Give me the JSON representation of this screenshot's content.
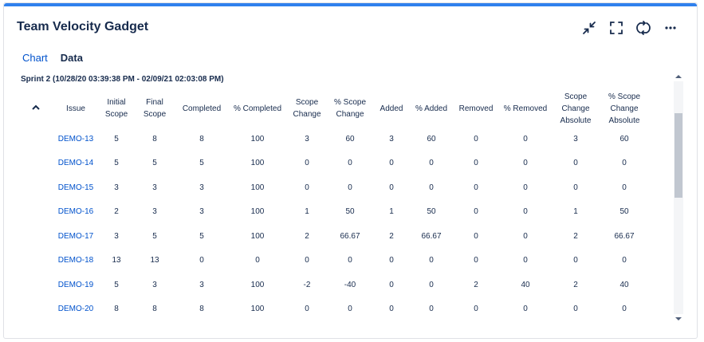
{
  "gadget": {
    "title": "Team Velocity Gadget"
  },
  "tabs": [
    {
      "label": "Chart",
      "active": false
    },
    {
      "label": "Data",
      "active": true
    }
  ],
  "sprint_label": "Sprint 2 (10/28/20 03:39:38 PM - 02/09/21 02:03:08 PM)",
  "columns": [
    {
      "key": "issue",
      "label": "Issue"
    },
    {
      "key": "initial_scope",
      "label": "Initial Scope"
    },
    {
      "key": "final_scope",
      "label": "Final Scope"
    },
    {
      "key": "completed",
      "label": "Completed"
    },
    {
      "key": "pct_completed",
      "label": "% Completed"
    },
    {
      "key": "scope_change",
      "label": "Scope Change"
    },
    {
      "key": "pct_scope_change",
      "label": "% Scope Change"
    },
    {
      "key": "added",
      "label": "Added"
    },
    {
      "key": "pct_added",
      "label": "% Added"
    },
    {
      "key": "removed",
      "label": "Removed"
    },
    {
      "key": "pct_removed",
      "label": "% Removed"
    },
    {
      "key": "scope_change_abs",
      "label": "Scope Change Absolute"
    },
    {
      "key": "pct_scope_change_abs",
      "label": "% Scope Change Absolute"
    }
  ],
  "rows": [
    [
      "DEMO-13",
      "5",
      "8",
      "8",
      "100",
      "3",
      "60",
      "3",
      "60",
      "0",
      "0",
      "3",
      "60"
    ],
    [
      "DEMO-14",
      "5",
      "5",
      "5",
      "100",
      "0",
      "0",
      "0",
      "0",
      "0",
      "0",
      "0",
      "0"
    ],
    [
      "DEMO-15",
      "3",
      "3",
      "3",
      "100",
      "0",
      "0",
      "0",
      "0",
      "0",
      "0",
      "0",
      "0"
    ],
    [
      "DEMO-16",
      "2",
      "3",
      "3",
      "100",
      "1",
      "50",
      "1",
      "50",
      "0",
      "0",
      "1",
      "50"
    ],
    [
      "DEMO-17",
      "3",
      "5",
      "5",
      "100",
      "2",
      "66.67",
      "2",
      "66.67",
      "0",
      "0",
      "2",
      "66.67"
    ],
    [
      "DEMO-18",
      "13",
      "13",
      "0",
      "0",
      "0",
      "0",
      "0",
      "0",
      "0",
      "0",
      "0",
      "0"
    ],
    [
      "DEMO-19",
      "5",
      "3",
      "3",
      "100",
      "-2",
      "-40",
      "0",
      "0",
      "2",
      "40",
      "2",
      "40"
    ],
    [
      "DEMO-20",
      "8",
      "8",
      "8",
      "100",
      "0",
      "0",
      "0",
      "0",
      "0",
      "0",
      "0",
      "0"
    ]
  ],
  "icons": {
    "minimize": "minimize-icon",
    "fullscreen": "fullscreen-icon",
    "refresh": "refresh-icon",
    "more": "more-icon",
    "collapse": "chevron-up-icon"
  },
  "colors": {
    "accent": "#2f80ed",
    "link": "#0052cc",
    "text": "#172b4d"
  }
}
